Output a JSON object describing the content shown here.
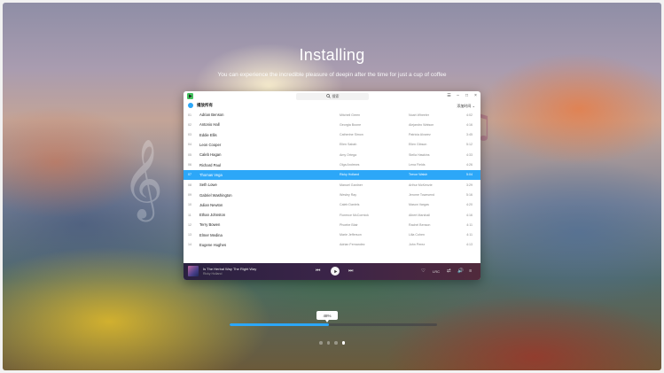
{
  "installer": {
    "title": "Installing",
    "subtitle": "You can experience the incredible pleasure of deepin after the time for just a cup of coffee",
    "progress_percent": 48,
    "progress_label": "48%",
    "carousel": {
      "count": 4,
      "active_index": 3
    }
  },
  "app": {
    "search_placeholder": "搜索",
    "window_controls": [
      "☰",
      "–",
      "□",
      "×"
    ],
    "playlist_title": "播放所有",
    "sort_label": "添加时间",
    "sort_chevron": "⌄",
    "tracks": [
      {
        "idx": "01",
        "song": "Adrian Benson",
        "artist": "Mitchell Green",
        "album": "Noah Wheeler",
        "dur": "4:02"
      },
      {
        "idx": "02",
        "song": "Antonio Hall",
        "artist": "Georgia Boone",
        "album": "Alejandro Watson",
        "dur": "4:16"
      },
      {
        "idx": "03",
        "song": "Eddie Ellis",
        "artist": "Catherine Simon",
        "album": "Patricia Alvarez",
        "dur": "3:45"
      },
      {
        "idx": "04",
        "song": "Leon Cooper",
        "artist": "Ellen Sabah",
        "album": "Ellen Gibson",
        "dur": "5:12"
      },
      {
        "idx": "05",
        "song": "Caleb Hagan",
        "artist": "Amy Ortega",
        "album": "Stella Hawkins",
        "dur": "4:33"
      },
      {
        "idx": "06",
        "song": "Richard Paul",
        "artist": "Olga Andrews",
        "album": "Lena Fields",
        "dur": "4:26"
      },
      {
        "idx": "07",
        "song": "Thomas Vega",
        "artist": "Ricky Holland",
        "album": "Trevor Walsh",
        "dur": "5:04"
      },
      {
        "idx": "08",
        "song": "Seth Lowe",
        "artist": "Manuel Gardner",
        "album": "Arthur McKenzie",
        "dur": "3:29"
      },
      {
        "idx": "09",
        "song": "Gabriel Washington",
        "artist": "Wesley Ray",
        "album": "Jerome Townsend",
        "dur": "5:16"
      },
      {
        "idx": "10",
        "song": "Julian Newton",
        "artist": "Caleb Daniels",
        "album": "Mason Vargas",
        "dur": "4:20"
      },
      {
        "idx": "11",
        "song": "Ethan Johnston",
        "artist": "Florence McCormick",
        "album": "Albert Marshall",
        "dur": "4:16"
      },
      {
        "idx": "12",
        "song": "Terry Bowen",
        "artist": "Phoebe Blair",
        "album": "Rachel Benson",
        "dur": "4:11"
      },
      {
        "idx": "13",
        "song": "Elmer Medina",
        "artist": "Marie Jefferson",
        "album": "Lilia Cohen",
        "dur": "4:11"
      },
      {
        "idx": "14",
        "song": "Eugene Hughes",
        "artist": "Adrian Fernandez",
        "album": "John Perez",
        "dur": "4:13"
      }
    ],
    "active_track_index": 6,
    "now_playing": {
      "title": "Is The Herbal Way The Right Way",
      "artist": "Ricky Holland",
      "prev_icon": "⏮",
      "next_icon": "⏭",
      "lyrics_label": "LRC",
      "icons": [
        "♡",
        "⇄",
        "🔊",
        "≡"
      ]
    }
  },
  "colors": {
    "accent": "#2ca7f8",
    "player_bg": "#3b2448",
    "window_bg": "#ffffff"
  }
}
